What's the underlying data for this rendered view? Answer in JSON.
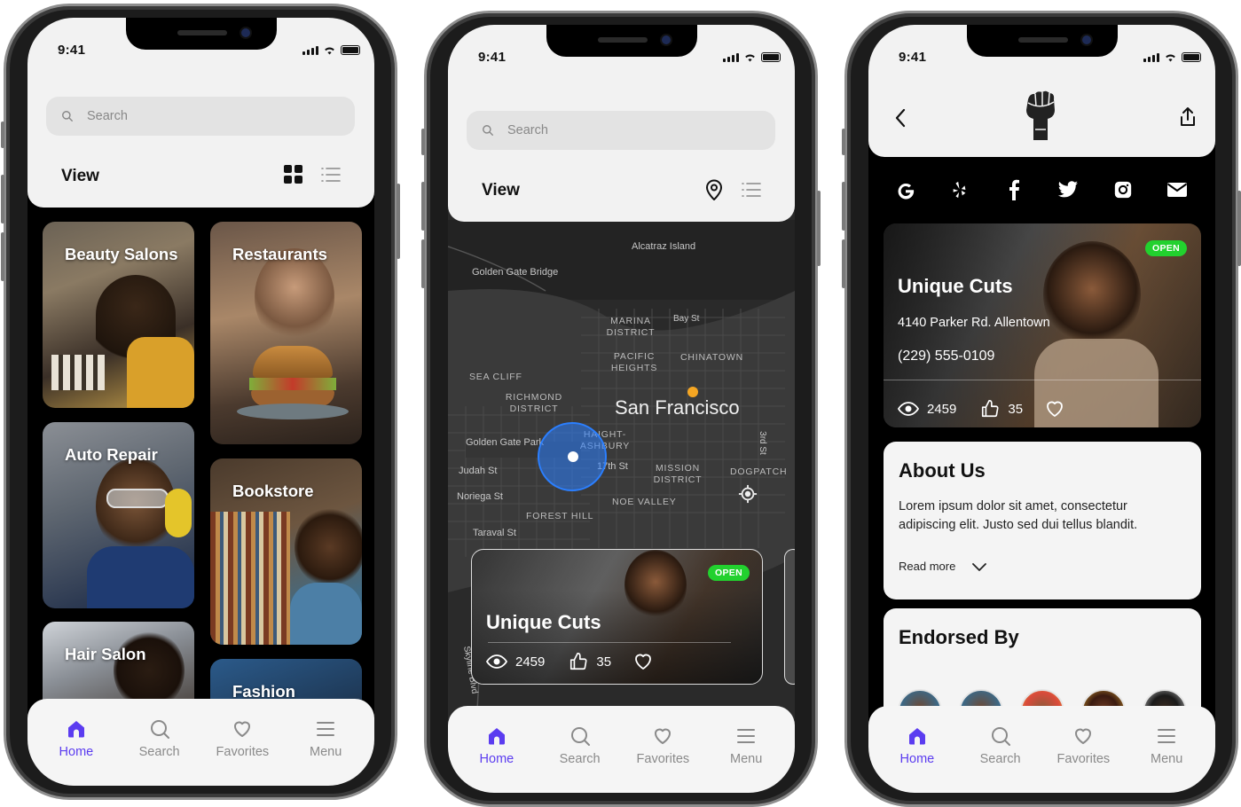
{
  "status": {
    "time": "9:41"
  },
  "tabbar": [
    {
      "label": "Home",
      "icon": "home-icon",
      "active": true
    },
    {
      "label": "Search",
      "icon": "search-icon",
      "active": false
    },
    {
      "label": "Favorites",
      "icon": "heart-icon",
      "active": false
    },
    {
      "label": "Menu",
      "icon": "menu-icon",
      "active": false
    }
  ],
  "phone1": {
    "search_placeholder": "Search",
    "view_label": "View",
    "categories": [
      {
        "label": "Beauty Salons"
      },
      {
        "label": "Restaurants"
      },
      {
        "label": "Auto Repair"
      },
      {
        "label": "Bookstore"
      },
      {
        "label": "Hair Salon"
      },
      {
        "label": "Fashion"
      }
    ]
  },
  "phone2": {
    "search_placeholder": "Search",
    "view_label": "View",
    "map": {
      "city": "San Francisco",
      "labels": [
        "Alcatraz Island",
        "Golden Gate Bridge",
        "MARINA DISTRICT",
        "Bay St",
        "PACIFIC HEIGHTS",
        "CHINATOWN",
        "SEA CLIFF",
        "RICHMOND DISTRICT",
        "HAIGHT-ASHBURY",
        "Golden Gate Park",
        "Judah St",
        "17th St",
        "MISSION DISTRICT",
        "DOGPATCH",
        "Noriega St",
        "NOE VALLEY",
        "FOREST HILL",
        "Taraval St",
        "3rd St",
        "Skyline Blvd"
      ]
    },
    "business": {
      "name": "Unique Cuts",
      "badge": "OPEN",
      "views": "2459",
      "likes": "35"
    }
  },
  "phone3": {
    "social": [
      "google-icon",
      "yelp-icon",
      "facebook-icon",
      "twitter-icon",
      "instagram-icon",
      "mail-icon"
    ],
    "business": {
      "name": "Unique Cuts",
      "badge": "OPEN",
      "address": "4140 Parker Rd. Allentown",
      "phone": "(229) 555-0109",
      "views": "2459",
      "likes": "35"
    },
    "about": {
      "title": "About Us",
      "text": "Lorem ipsum dolor sit amet, consectetur adipiscing elit. Justo sed dui tellus blandit.",
      "read_more": "Read more"
    },
    "endorsed": {
      "title": "Endorsed By"
    }
  },
  "colors": {
    "accent": "#5b3cf0",
    "open": "#22d12e",
    "map_pin": "#f5a623",
    "user_dot": "#2b7fff"
  }
}
